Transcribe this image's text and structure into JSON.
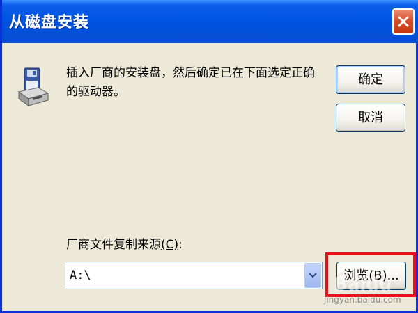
{
  "window": {
    "title": "从磁盘安装",
    "close_label": "×"
  },
  "message": {
    "text": "插入厂商的安装盘，然后确定已在下面选定正确的驱动器。"
  },
  "buttons": {
    "ok": "确定",
    "cancel": "取消",
    "browse": "浏览(B)..."
  },
  "source": {
    "label": "厂商文件复制来源",
    "accesskey_text": "(C)",
    "colon": ":",
    "value": "A:\\"
  },
  "watermark": {
    "brand": "Baidu",
    "url": "jingyan.baidu.com"
  },
  "icons": {
    "close": "close-icon",
    "drive": "floppy-drive-icon",
    "dropdown": "chevron-down-icon"
  },
  "colors": {
    "titlebar": "#0054e3",
    "window_bg": "#ece9d8",
    "close_button": "#d8512b",
    "highlight_box": "#e8101b",
    "combo_border": "#7f9db9"
  }
}
